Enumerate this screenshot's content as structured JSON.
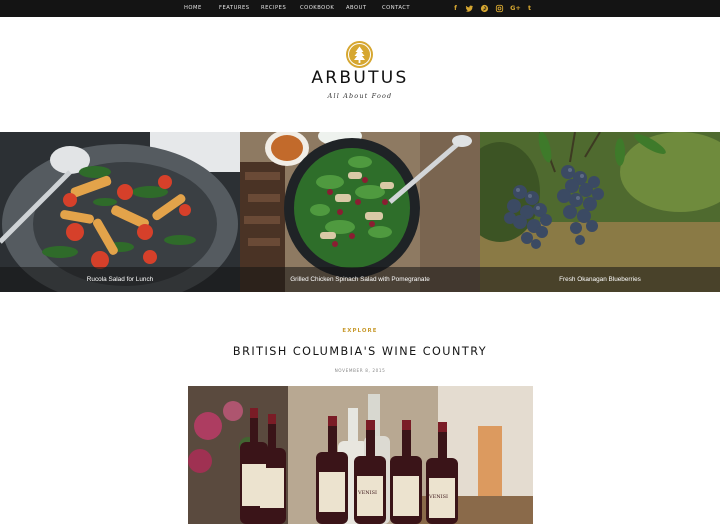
{
  "nav": {
    "items": [
      "HOME",
      "FEATURES",
      "RECIPES",
      "COOKBOOK",
      "ABOUT",
      "CONTACT"
    ]
  },
  "social": {
    "icons": [
      "facebook-icon",
      "twitter-icon",
      "pinterest-icon",
      "instagram-icon",
      "google-plus-icon",
      "tumblr-icon"
    ],
    "glyphs": [
      "f",
      "t",
      "p",
      "◎",
      "G+",
      "t"
    ]
  },
  "header": {
    "title": "ARBUTUS",
    "tagline": "All About Food"
  },
  "featured": [
    {
      "caption": "Rucola Salad for Lunch"
    },
    {
      "caption": "Grilled Chicken Spinach Salad with Pomegranate"
    },
    {
      "caption": "Fresh Okanagan Blueberries"
    }
  ],
  "post": {
    "category": "EXPLORE",
    "title": "BRITISH COLUMBIA'S WINE COUNTRY",
    "date": "NOVEMBER 8, 2015",
    "bottle_label_text": "VENISI"
  },
  "colors": {
    "accent": "#d6a731",
    "topbar": "#141414"
  }
}
